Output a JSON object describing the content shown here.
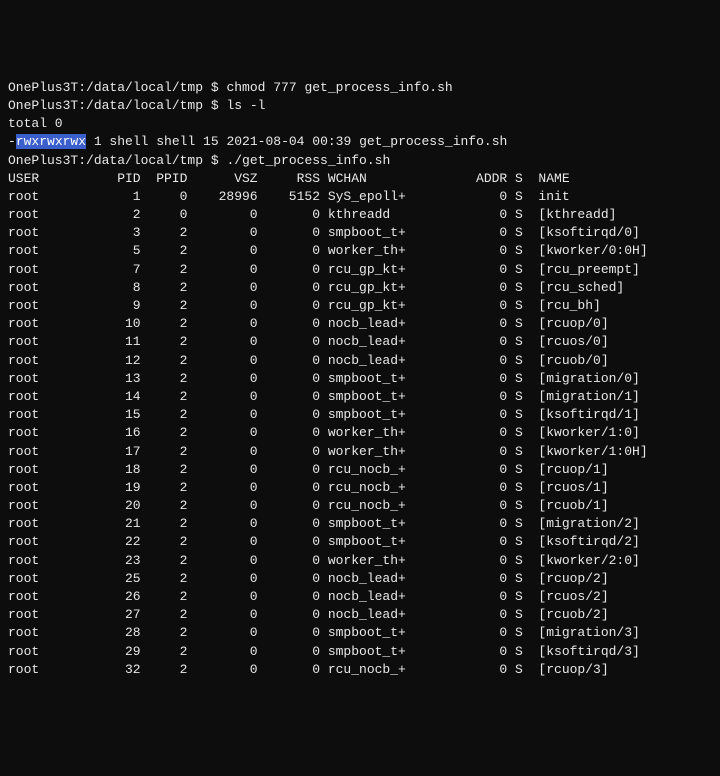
{
  "prompt_prefix": "OnePlus3T:/data/local/tmp $ ",
  "cmd1": "chmod 777 get_process_info.sh",
  "cmd2": "ls -l",
  "total_line": "total 0",
  "ls_perm_dash": "-",
  "ls_perm_hl": "rwxrwxrwx",
  "ls_rest": " 1 shell shell 15 2021-08-04 00:39 get_process_info.sh",
  "cmd3": "./get_process_info.sh",
  "headers": {
    "user": "USER",
    "pid": "PID",
    "ppid": "PPID",
    "vsz": "VSZ",
    "rss": "RSS",
    "wchan": "WCHAN",
    "addr": "ADDR",
    "s": "S",
    "name": "NAME"
  },
  "rows": [
    {
      "user": "root",
      "pid": "1",
      "ppid": "0",
      "vsz": "28996",
      "rss": "5152",
      "wchan": "SyS_epoll+",
      "addr": "0",
      "s": "S",
      "name": "init"
    },
    {
      "user": "root",
      "pid": "2",
      "ppid": "0",
      "vsz": "0",
      "rss": "0",
      "wchan": "kthreadd",
      "addr": "0",
      "s": "S",
      "name": "[kthreadd]"
    },
    {
      "user": "root",
      "pid": "3",
      "ppid": "2",
      "vsz": "0",
      "rss": "0",
      "wchan": "smpboot_t+",
      "addr": "0",
      "s": "S",
      "name": "[ksoftirqd/0]"
    },
    {
      "user": "root",
      "pid": "5",
      "ppid": "2",
      "vsz": "0",
      "rss": "0",
      "wchan": "worker_th+",
      "addr": "0",
      "s": "S",
      "name": "[kworker/0:0H]"
    },
    {
      "user": "root",
      "pid": "7",
      "ppid": "2",
      "vsz": "0",
      "rss": "0",
      "wchan": "rcu_gp_kt+",
      "addr": "0",
      "s": "S",
      "name": "[rcu_preempt]"
    },
    {
      "user": "root",
      "pid": "8",
      "ppid": "2",
      "vsz": "0",
      "rss": "0",
      "wchan": "rcu_gp_kt+",
      "addr": "0",
      "s": "S",
      "name": "[rcu_sched]"
    },
    {
      "user": "root",
      "pid": "9",
      "ppid": "2",
      "vsz": "0",
      "rss": "0",
      "wchan": "rcu_gp_kt+",
      "addr": "0",
      "s": "S",
      "name": "[rcu_bh]"
    },
    {
      "user": "root",
      "pid": "10",
      "ppid": "2",
      "vsz": "0",
      "rss": "0",
      "wchan": "nocb_lead+",
      "addr": "0",
      "s": "S",
      "name": "[rcuop/0]"
    },
    {
      "user": "root",
      "pid": "11",
      "ppid": "2",
      "vsz": "0",
      "rss": "0",
      "wchan": "nocb_lead+",
      "addr": "0",
      "s": "S",
      "name": "[rcuos/0]"
    },
    {
      "user": "root",
      "pid": "12",
      "ppid": "2",
      "vsz": "0",
      "rss": "0",
      "wchan": "nocb_lead+",
      "addr": "0",
      "s": "S",
      "name": "[rcuob/0]"
    },
    {
      "user": "root",
      "pid": "13",
      "ppid": "2",
      "vsz": "0",
      "rss": "0",
      "wchan": "smpboot_t+",
      "addr": "0",
      "s": "S",
      "name": "[migration/0]"
    },
    {
      "user": "root",
      "pid": "14",
      "ppid": "2",
      "vsz": "0",
      "rss": "0",
      "wchan": "smpboot_t+",
      "addr": "0",
      "s": "S",
      "name": "[migration/1]"
    },
    {
      "user": "root",
      "pid": "15",
      "ppid": "2",
      "vsz": "0",
      "rss": "0",
      "wchan": "smpboot_t+",
      "addr": "0",
      "s": "S",
      "name": "[ksoftirqd/1]"
    },
    {
      "user": "root",
      "pid": "16",
      "ppid": "2",
      "vsz": "0",
      "rss": "0",
      "wchan": "worker_th+",
      "addr": "0",
      "s": "S",
      "name": "[kworker/1:0]"
    },
    {
      "user": "root",
      "pid": "17",
      "ppid": "2",
      "vsz": "0",
      "rss": "0",
      "wchan": "worker_th+",
      "addr": "0",
      "s": "S",
      "name": "[kworker/1:0H]"
    },
    {
      "user": "root",
      "pid": "18",
      "ppid": "2",
      "vsz": "0",
      "rss": "0",
      "wchan": "rcu_nocb_+",
      "addr": "0",
      "s": "S",
      "name": "[rcuop/1]"
    },
    {
      "user": "root",
      "pid": "19",
      "ppid": "2",
      "vsz": "0",
      "rss": "0",
      "wchan": "rcu_nocb_+",
      "addr": "0",
      "s": "S",
      "name": "[rcuos/1]"
    },
    {
      "user": "root",
      "pid": "20",
      "ppid": "2",
      "vsz": "0",
      "rss": "0",
      "wchan": "rcu_nocb_+",
      "addr": "0",
      "s": "S",
      "name": "[rcuob/1]"
    },
    {
      "user": "root",
      "pid": "21",
      "ppid": "2",
      "vsz": "0",
      "rss": "0",
      "wchan": "smpboot_t+",
      "addr": "0",
      "s": "S",
      "name": "[migration/2]"
    },
    {
      "user": "root",
      "pid": "22",
      "ppid": "2",
      "vsz": "0",
      "rss": "0",
      "wchan": "smpboot_t+",
      "addr": "0",
      "s": "S",
      "name": "[ksoftirqd/2]"
    },
    {
      "user": "root",
      "pid": "23",
      "ppid": "2",
      "vsz": "0",
      "rss": "0",
      "wchan": "worker_th+",
      "addr": "0",
      "s": "S",
      "name": "[kworker/2:0]"
    },
    {
      "user": "root",
      "pid": "25",
      "ppid": "2",
      "vsz": "0",
      "rss": "0",
      "wchan": "nocb_lead+",
      "addr": "0",
      "s": "S",
      "name": "[rcuop/2]"
    },
    {
      "user": "root",
      "pid": "26",
      "ppid": "2",
      "vsz": "0",
      "rss": "0",
      "wchan": "nocb_lead+",
      "addr": "0",
      "s": "S",
      "name": "[rcuos/2]"
    },
    {
      "user": "root",
      "pid": "27",
      "ppid": "2",
      "vsz": "0",
      "rss": "0",
      "wchan": "nocb_lead+",
      "addr": "0",
      "s": "S",
      "name": "[rcuob/2]"
    },
    {
      "user": "root",
      "pid": "28",
      "ppid": "2",
      "vsz": "0",
      "rss": "0",
      "wchan": "smpboot_t+",
      "addr": "0",
      "s": "S",
      "name": "[migration/3]"
    },
    {
      "user": "root",
      "pid": "29",
      "ppid": "2",
      "vsz": "0",
      "rss": "0",
      "wchan": "smpboot_t+",
      "addr": "0",
      "s": "S",
      "name": "[ksoftirqd/3]"
    },
    {
      "user": "root",
      "pid": "32",
      "ppid": "2",
      "vsz": "0",
      "rss": "0",
      "wchan": "rcu_nocb_+",
      "addr": "0",
      "s": "S",
      "name": "[rcuop/3]"
    }
  ]
}
